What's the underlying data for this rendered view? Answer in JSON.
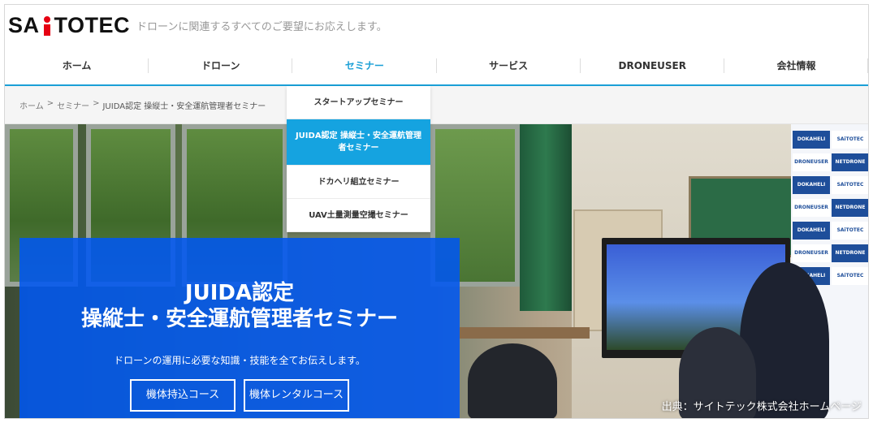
{
  "header": {
    "logo_text": "SAiTOTEC",
    "logo_left": "SA",
    "logo_right": "TOTEC",
    "tagline": "ドローンに関連するすべてのご要望にお応えします。"
  },
  "nav": {
    "items": [
      {
        "label": "ホーム"
      },
      {
        "label": "ドローン"
      },
      {
        "label": "セミナー",
        "active": true
      },
      {
        "label": "サービス"
      },
      {
        "label": "DRONEUSER"
      },
      {
        "label": "会社情報"
      }
    ]
  },
  "breadcrumb": {
    "items": [
      "ホーム",
      ">",
      "セミナー",
      ">",
      "JUIDA認定 操縦士・安全運航管理者セミナー"
    ]
  },
  "dropdown": {
    "items": [
      {
        "label": "スタートアップセミナー"
      },
      {
        "label": "JUIDA認定 操縦士・安全運航管理者セミナー",
        "active": true
      },
      {
        "label": "ドカヘリ組立セミナー"
      },
      {
        "label": "UAV土量測量空撮セミナー"
      }
    ]
  },
  "hero": {
    "title_line1": "JUIDA認定",
    "title_line2": "操縦士・安全運航管理者セミナー",
    "subtitle": "ドローンの運用に必要な知識・技能を全てお伝えします。",
    "btn_own": "機体持込コース",
    "btn_rental": "機体レンタルコース"
  },
  "banner": {
    "texts": [
      "DOKAHELI",
      "SAiTOTEC",
      "DRONEUSER",
      "NETDRONE"
    ]
  },
  "credit": "出典：サイトテック株式会社ホームページ",
  "colors": {
    "accent": "#1a9fd6",
    "hero_blue": "#0056f0",
    "logo_red": "#e60012"
  }
}
